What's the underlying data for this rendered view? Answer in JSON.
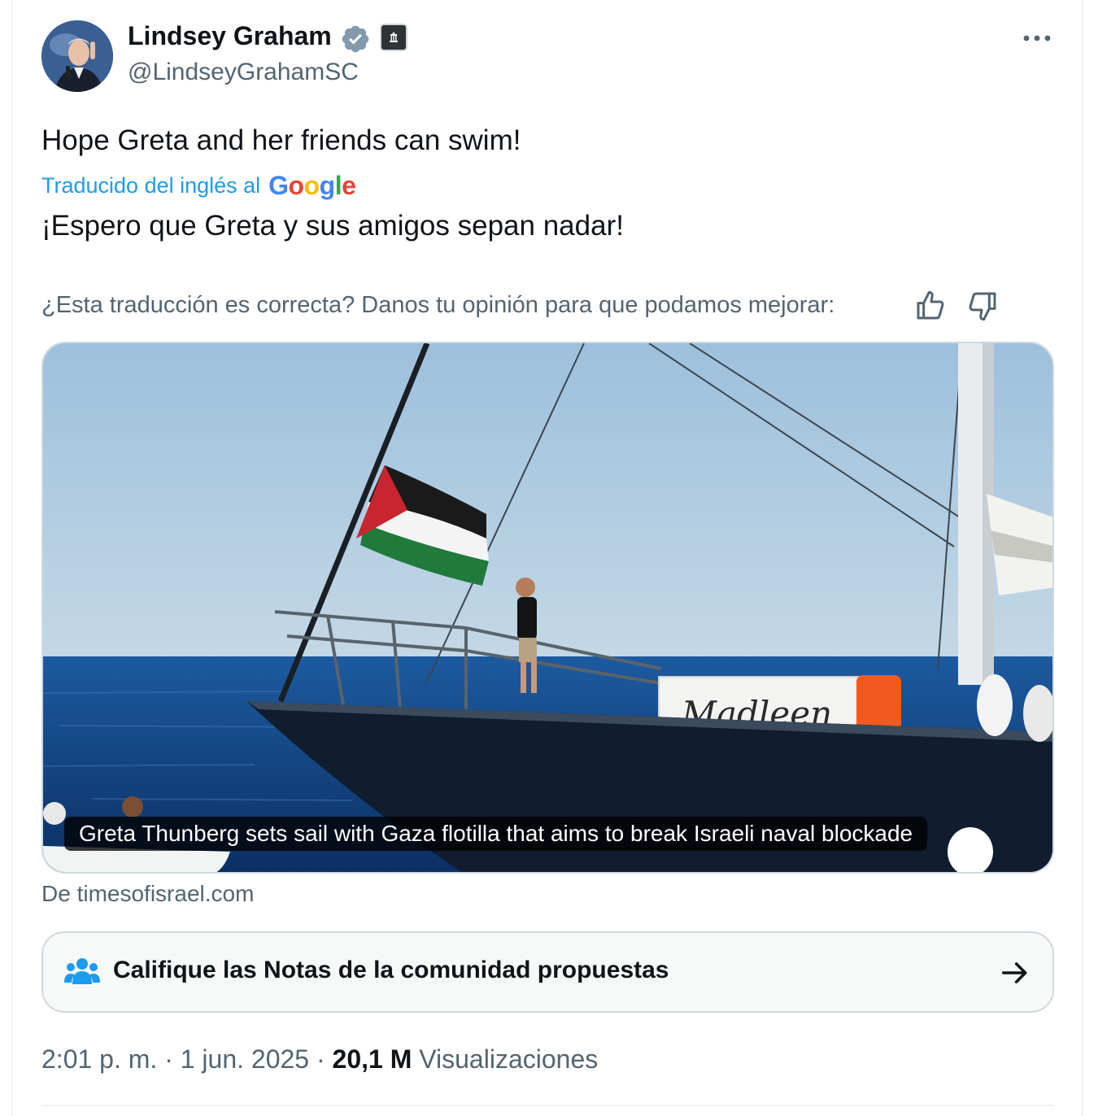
{
  "author": {
    "display_name": "Lindsey Graham",
    "handle": "@LindseyGrahamSC",
    "verified_badge_color": "#829aab"
  },
  "tweet": {
    "text": "Hope Greta and her friends can swim!",
    "translated_label": "Traducido del inglés al",
    "translator_brand": [
      "G",
      "o",
      "o",
      "g",
      "l",
      "e"
    ],
    "translation": "¡Espero que Greta y sus amigos sepan nadar!",
    "feedback_question": "¿Esta traducción es correcta? Danos tu opinión para que podamos mejorar:"
  },
  "card": {
    "caption": "Greta Thunberg sets sail with Gaza flotilla that aims to break Israeli naval blockade",
    "boat_name": "Madleen",
    "source": "De timesofisrael.com"
  },
  "community_notes": {
    "label": "Califique las Notas de la comunidad propuestas"
  },
  "meta": {
    "time": "2:01 p. m.",
    "separator": "·",
    "date": "1 jun. 2025",
    "views_count": "20,1 M",
    "views_label": "Visualizaciones"
  },
  "icons": {
    "more": "more-horizontal-icon",
    "thumb_up": "thumbs-up-icon",
    "thumb_down": "thumbs-down-icon",
    "community": "people-icon",
    "arrow": "arrow-right-icon",
    "verified": "verified-badge-icon",
    "affiliation": "government-building-icon"
  },
  "colors": {
    "accent_blue": "#1d9bf0",
    "text_primary": "#0f1419",
    "text_secondary": "#536471",
    "border": "#cfd9de",
    "google": [
      "#4285f4",
      "#ea4335",
      "#fbbc05",
      "#4285f4",
      "#34a853",
      "#ea4335"
    ]
  }
}
